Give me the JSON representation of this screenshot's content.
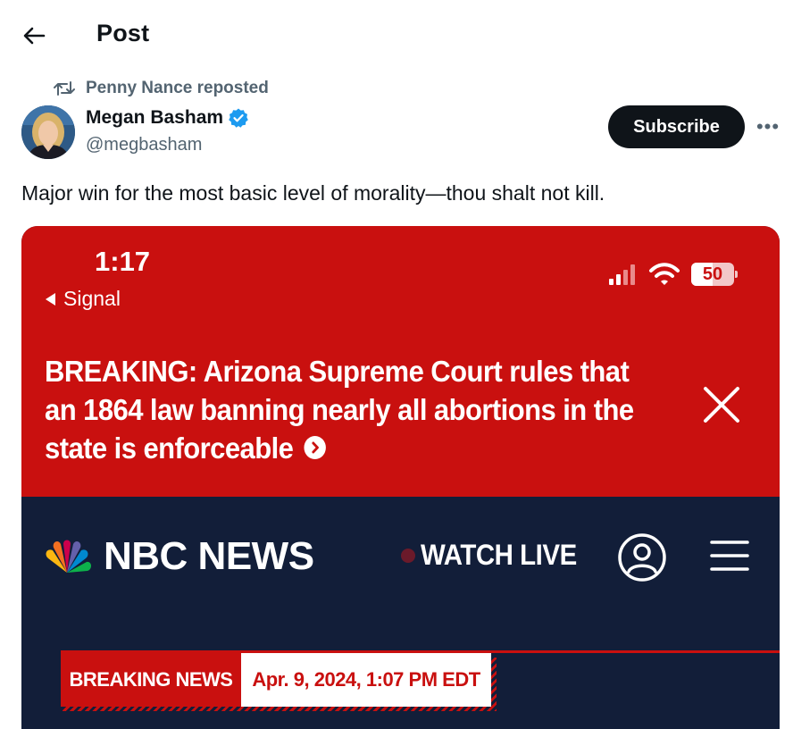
{
  "header": {
    "title": "Post"
  },
  "repost": {
    "text": "Penny Nance reposted"
  },
  "author": {
    "name": "Megan Basham",
    "handle": "@megbasham"
  },
  "actions": {
    "subscribe_label": "Subscribe",
    "more_label": "•••"
  },
  "post": {
    "text": "Major win for the most basic level of morality—thou shalt not kill."
  },
  "media": {
    "status_time": "1:17",
    "back_app": "Signal",
    "battery_level": "50",
    "breaking_headline": "BREAKING: Arizona Supreme Court rules that an 1864 law banning nearly all abortions in the state is enforceable",
    "brand": "NBC NEWS",
    "watch_live": "WATCH LIVE",
    "banner_label": "BREAKING NEWS",
    "banner_date": "Apr. 9, 2024, 1:07 PM EDT"
  },
  "colors": {
    "nbc_red": "#c9100f",
    "nbc_navy": "#121e39",
    "verified_blue": "#1d9bf0"
  },
  "icons": [
    "back-arrow-icon",
    "repost-icon",
    "verified-badge-icon",
    "more-icon",
    "signal-bars-icon",
    "wifi-icon",
    "battery-icon",
    "chevron-right-icon",
    "close-icon",
    "peacock-logo-icon",
    "account-icon",
    "hamburger-menu-icon"
  ]
}
